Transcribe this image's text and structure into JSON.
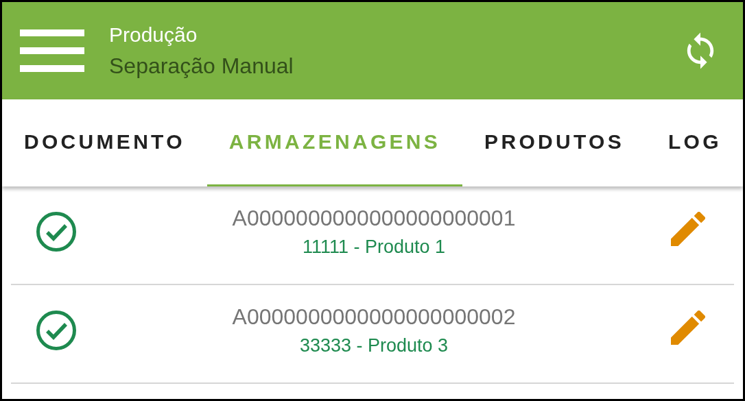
{
  "app_bar": {
    "title": "Produção",
    "subtitle": "Separação Manual"
  },
  "tabs": [
    {
      "label": "DOCUMENTO",
      "selected": false
    },
    {
      "label": "ARMAZENAGENS",
      "selected": true
    },
    {
      "label": "PRODUTOS",
      "selected": false
    },
    {
      "label": "LOG",
      "selected": false
    }
  ],
  "rows": [
    {
      "done": true,
      "code": "A0000000000000000000001",
      "product": "11111 - Produto 1"
    },
    {
      "done": true,
      "code": "A0000000000000000000002",
      "product": "33333 - Produto 3"
    }
  ]
}
